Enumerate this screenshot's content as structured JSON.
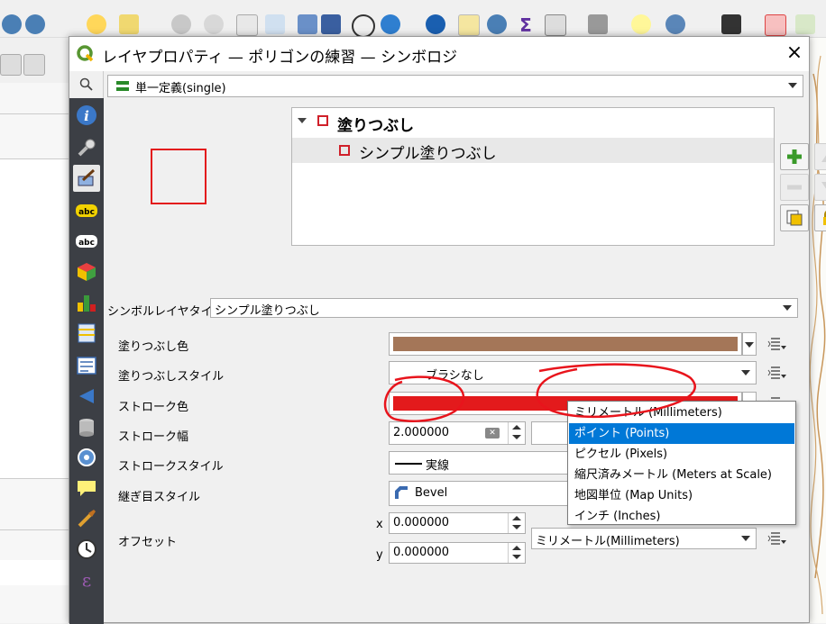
{
  "dialog": {
    "title": "レイヤプロパティ — ポリゴンの練習 — シンボロジ",
    "close": "×"
  },
  "renderer": {
    "selected": "単一定義(single)"
  },
  "symbol_tree": {
    "items": [
      {
        "label": "塗りつぶし",
        "level": 0
      },
      {
        "label": "シンプル塗りつぶし",
        "level": 1
      }
    ]
  },
  "layer_type": {
    "label": "シンボルレイヤタイプ",
    "value": "シンプル塗りつぶし"
  },
  "fields": {
    "fill_color": {
      "label": "塗りつぶし色",
      "color": "#a47658"
    },
    "fill_style": {
      "label": "塗りつぶしスタイル",
      "value": "ブラシなし"
    },
    "stroke_color": {
      "label": "ストローク色",
      "color": "#e31a1c"
    },
    "stroke_width": {
      "label": "ストローク幅",
      "value": "2.000000",
      "clear_icon": "✕"
    },
    "stroke_style": {
      "label": "ストロークスタイル",
      "value": "実線"
    },
    "join_style": {
      "label": "継ぎ目スタイル",
      "value": "Bevel"
    },
    "offset": {
      "label": "オフセット",
      "x_label": "x",
      "x_value": "0.000000",
      "y_label": "y",
      "y_value": "0.000000",
      "unit": "ミリメートル(Millimeters)"
    }
  },
  "unit_popup": {
    "items": [
      "ミリメートル (Millimeters)",
      "ポイント (Points)",
      "ピクセル (Pixels)",
      "縮尺済みメートル (Meters at Scale)",
      "地図単位 (Map Units)",
      "インチ (Inches)"
    ],
    "highlighted_index": 1
  },
  "sidebar_icons": [
    "search-icon",
    "info-icon",
    "source-icon",
    "symbology-icon",
    "labels-icon",
    "masks-icon",
    "3d-view-icon",
    "diagrams-icon",
    "fields-icon",
    "attributes-form-icon",
    "joins-icon",
    "auxiliary-storage-icon",
    "actions-icon",
    "display-icon",
    "rendering-icon",
    "temporal-icon",
    "variables-icon"
  ],
  "colors": {
    "accent": "#0078d7",
    "sidebar": "#3c3f45",
    "annotation": "#e8141c"
  }
}
